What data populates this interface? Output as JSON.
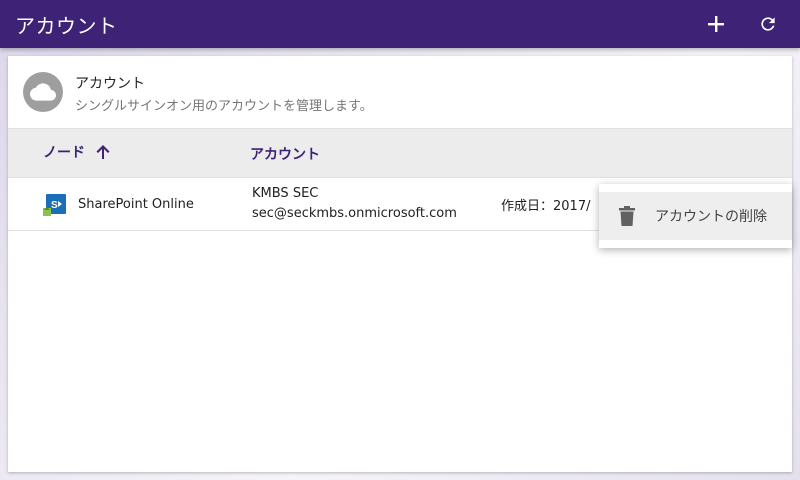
{
  "appbar": {
    "title": "アカウント",
    "add_icon": "plus-icon",
    "refresh_icon": "refresh-icon",
    "bg_color": "#3d2275"
  },
  "card": {
    "header": {
      "icon": "cloud-icon",
      "title": "アカウント",
      "subtitle": "シングルサインオン用のアカウントを管理します。"
    },
    "table": {
      "columns": [
        {
          "label": "ノード",
          "sort": "ascending",
          "sort_icon": "arrow-up-icon"
        },
        {
          "label": "アカウント"
        }
      ],
      "rows": [
        {
          "node_icon": "sharepoint-icon",
          "node": "SharePoint Online",
          "account_name": "KMBS SEC",
          "account_email": "sec@seckmbs.onmicrosoft.com",
          "created": "作成日：2017/"
        }
      ]
    }
  },
  "context_menu": {
    "items": [
      {
        "icon": "trash-icon",
        "label": "アカウントの削除"
      }
    ]
  }
}
